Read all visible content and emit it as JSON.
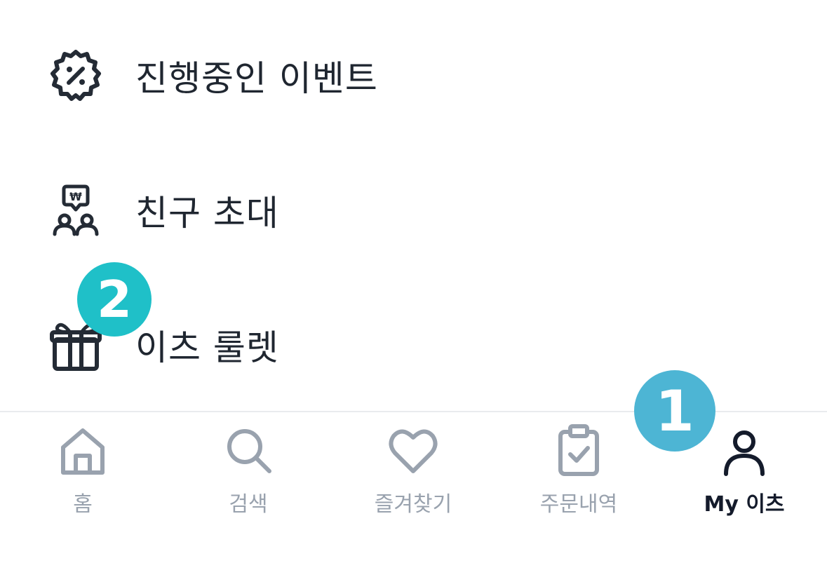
{
  "menu": {
    "items": [
      {
        "label": "진행중인 이벤트",
        "icon": "discount-badge-icon"
      },
      {
        "label": "친구 초대",
        "icon": "invite-friends-icon"
      },
      {
        "label": "이츠 룰렛",
        "icon": "gift-icon"
      }
    ]
  },
  "tabs": [
    {
      "label": "홈",
      "icon": "home-icon",
      "active": false
    },
    {
      "label": "검색",
      "icon": "search-icon",
      "active": false
    },
    {
      "label": "즐겨찾기",
      "icon": "heart-icon",
      "active": false
    },
    {
      "label": "주문내역",
      "icon": "clipboard-check-icon",
      "active": false
    },
    {
      "label": "My 이츠",
      "icon": "user-icon",
      "active": true
    }
  ],
  "annotations": {
    "step1": "1",
    "step2": "2"
  },
  "colors": {
    "text": "#1f2630",
    "tab_inactive": "#99a2ae",
    "tab_active": "#141b2b",
    "step1_badge": "#4db5d4",
    "step2_badge": "#1fc0c8"
  }
}
